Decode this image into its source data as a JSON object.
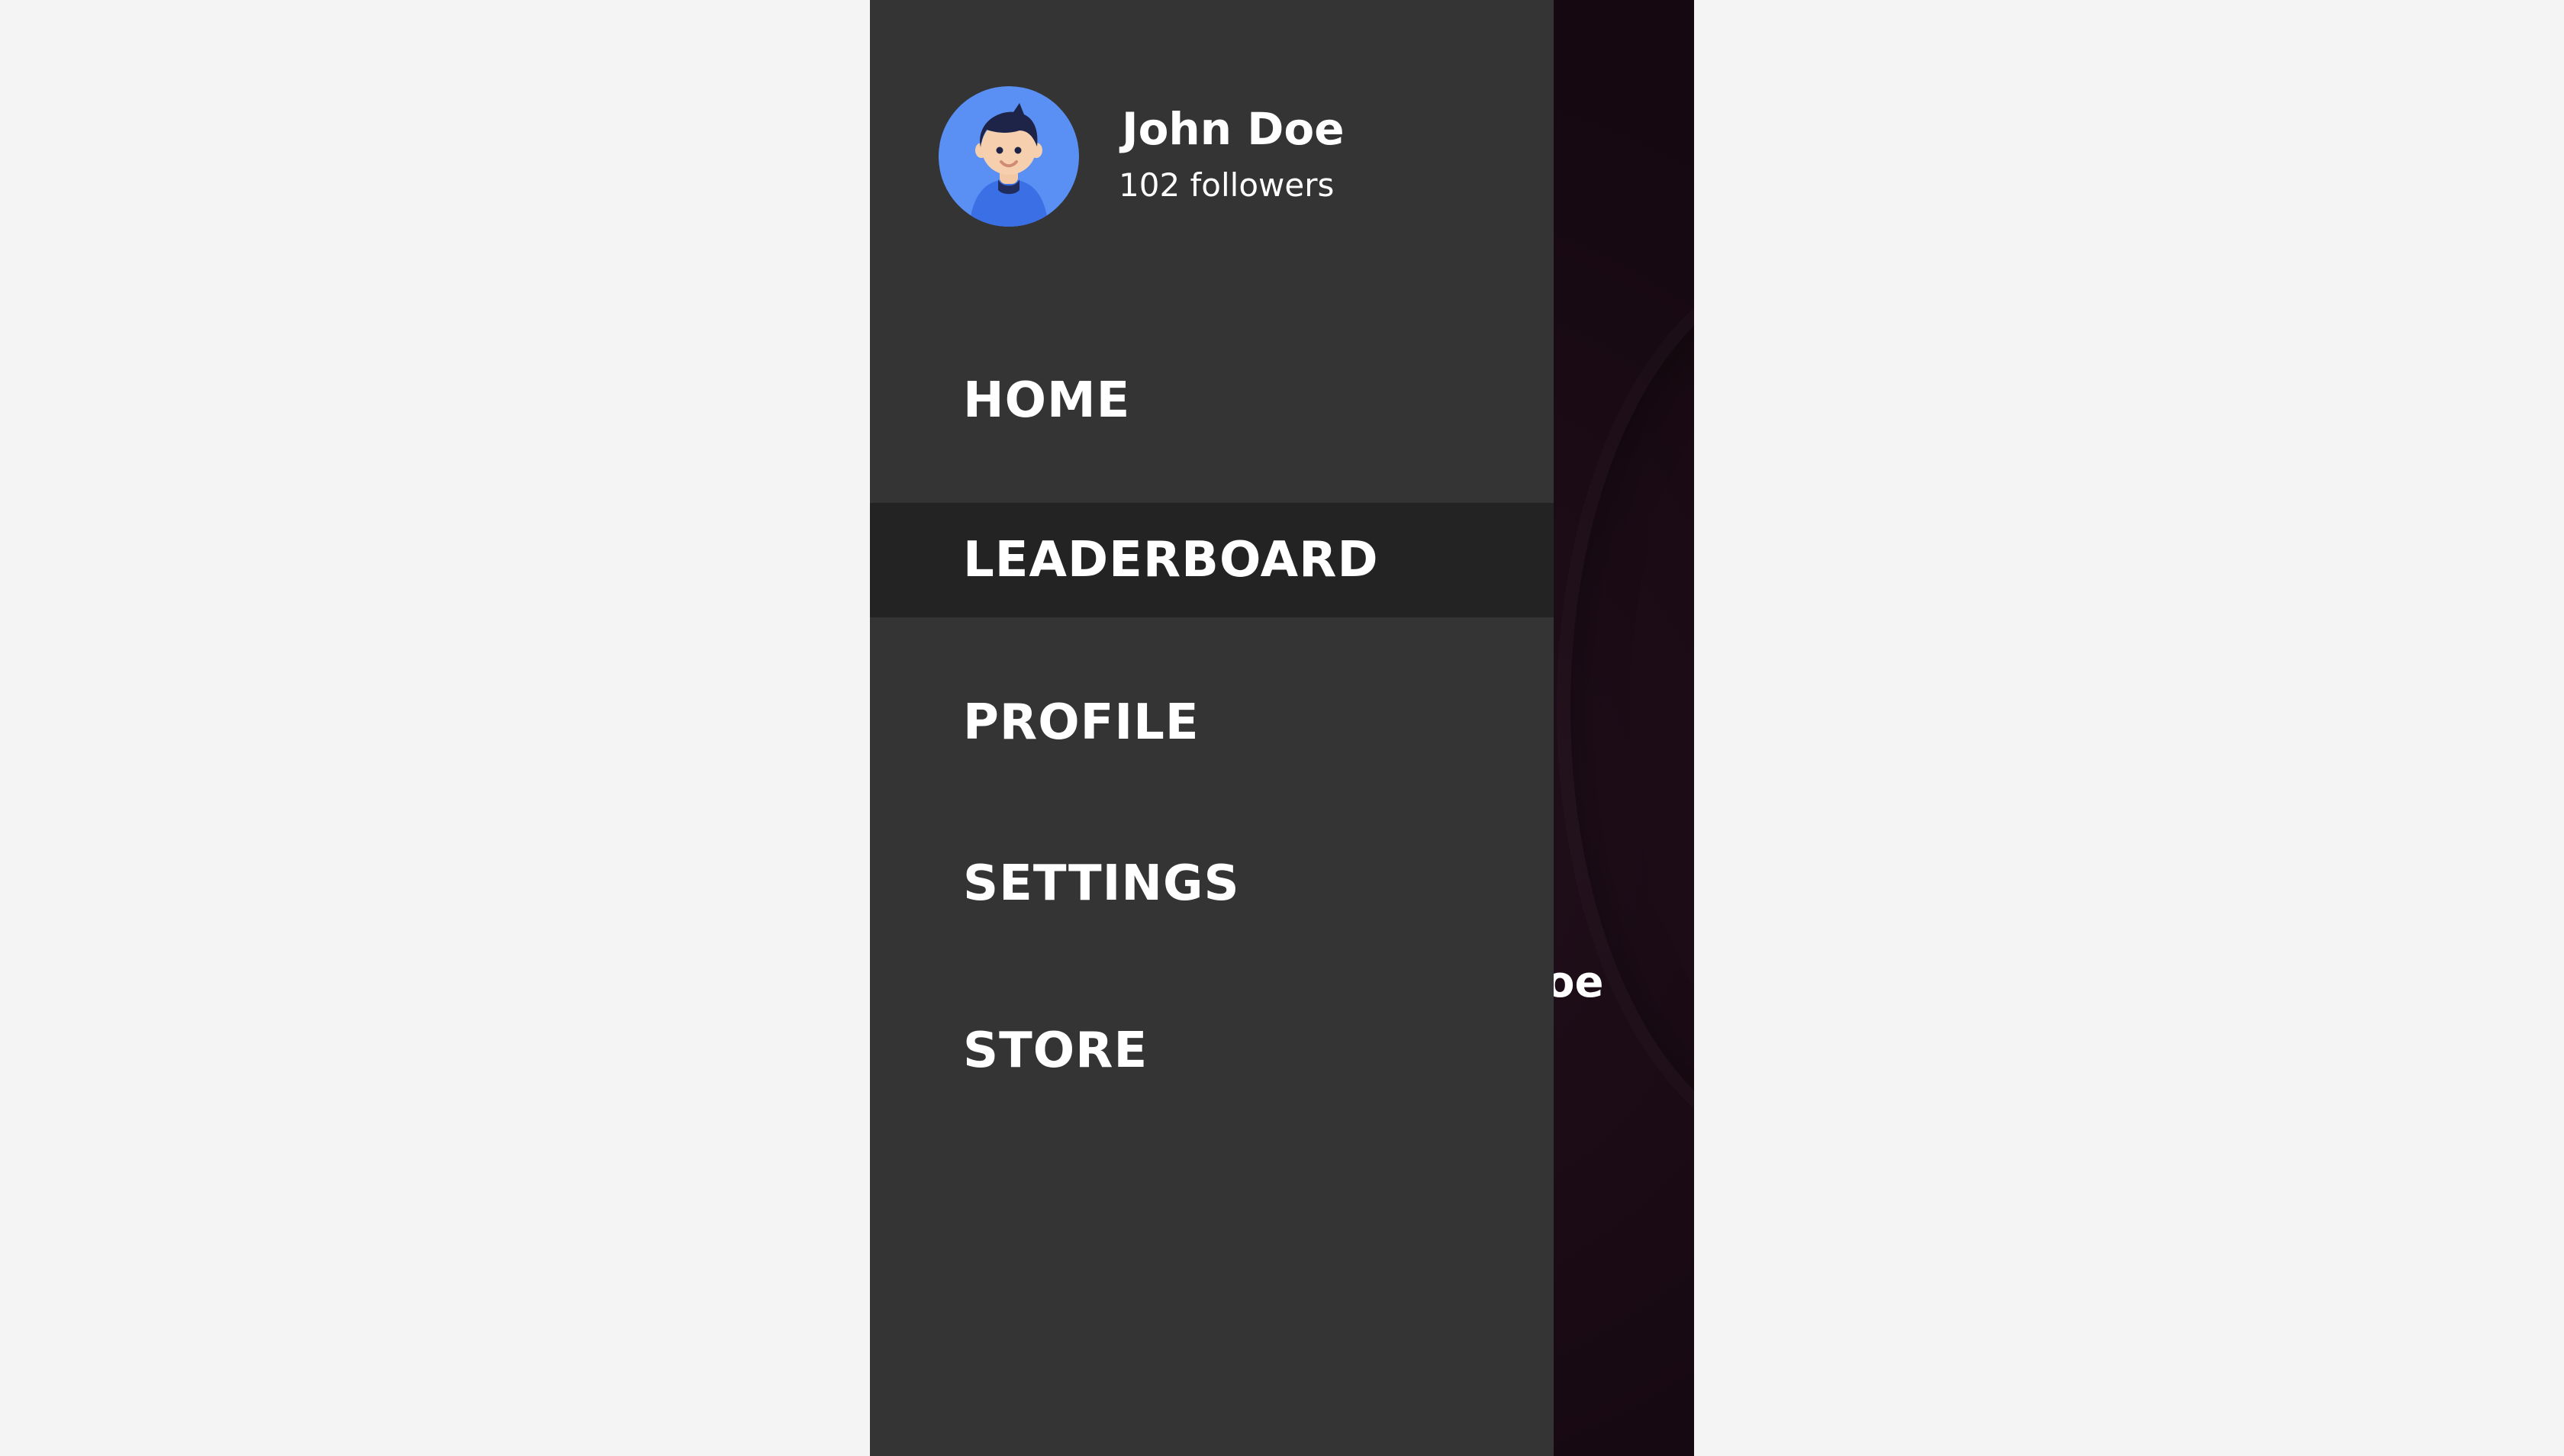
{
  "profile": {
    "name": "John Doe",
    "followers": "102 followers"
  },
  "menu": {
    "items": [
      {
        "label": "HOME"
      },
      {
        "label": "LEADERBOARD"
      },
      {
        "label": "PROFILE"
      },
      {
        "label": "SETTINGS"
      },
      {
        "label": "STORE"
      }
    ],
    "active_item": "LEADERBOARD"
  },
  "background": {
    "underlay_text": "John Doe"
  },
  "colors": {
    "page_background": "#f4f4f4",
    "drawer_background": "#343434",
    "active_item_background": "#232323",
    "underlay_background": "#1a0b14",
    "avatar_background": "#5a8ff3",
    "text": "#ffffff"
  },
  "icons": {
    "avatar": "user-avatar-icon"
  }
}
